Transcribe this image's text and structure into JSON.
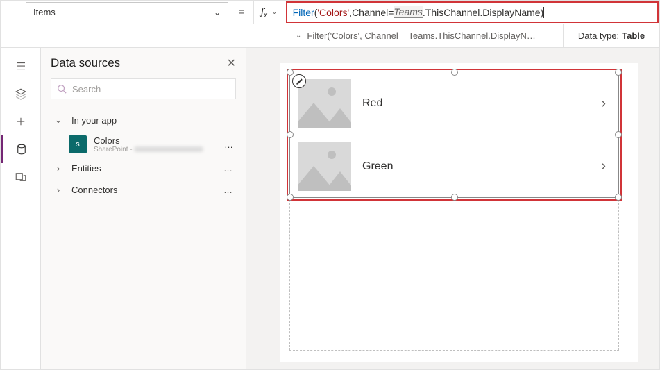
{
  "property_dropdown": "Items",
  "formula": {
    "fn": "Filter",
    "open": "(",
    "arg1": "'Colors'",
    "sep": ", ",
    "field": "Channel",
    "eq": " = ",
    "teams": "Teams",
    "path": ".ThisChannel.DisplayName",
    "close": ")",
    "preview": "Filter('Colors', Channel = Teams.ThisChannel.DisplayN…"
  },
  "datatype_label": "Data type:",
  "datatype_value": "Table",
  "panel": {
    "title": "Data sources",
    "search_placeholder": "Search",
    "groups": {
      "in_app": "In your app",
      "entities": "Entities",
      "connectors": "Connectors"
    },
    "datasource": {
      "name": "Colors",
      "connector": "SharePoint -"
    }
  },
  "gallery": {
    "items": [
      {
        "title": "Red"
      },
      {
        "title": "Green"
      }
    ]
  }
}
